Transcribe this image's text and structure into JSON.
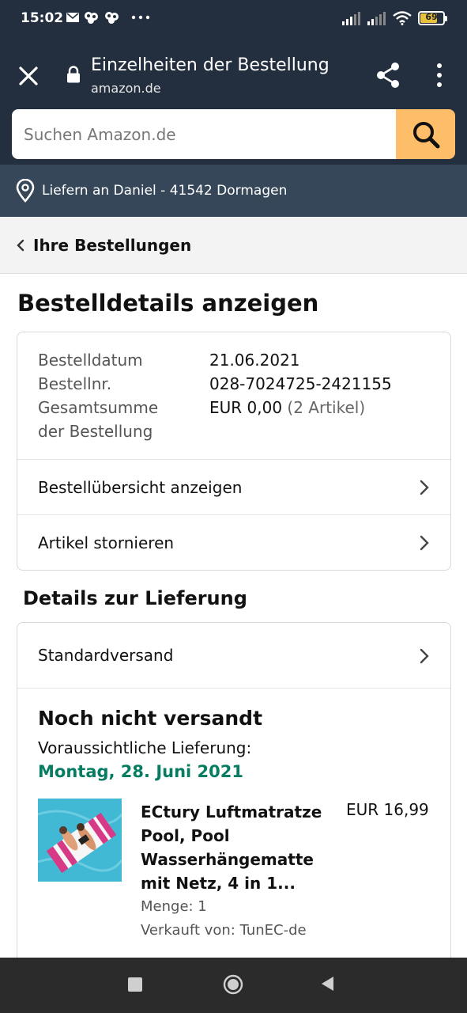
{
  "status_bar": {
    "time": "15:02",
    "battery": "69",
    "battery_level": 0.69,
    "icons": [
      "mail-icon",
      "notification-icon",
      "notification-icon",
      "more-dots-icon",
      "signal-icon",
      "signal-icon",
      "wifi-icon",
      "battery-icon"
    ]
  },
  "browser": {
    "title": "Einzelheiten der Bestellung",
    "domain": "amazon.de"
  },
  "search": {
    "placeholder": "Suchen Amazon.de",
    "button_color": "#febd69"
  },
  "delivery_bar": {
    "text": "Liefern an Daniel - 41542 Dormagen"
  },
  "back_nav": {
    "label": "Ihre Bestellungen"
  },
  "page_title": "Bestelldetails anzeigen",
  "order": {
    "date_label": "Bestelldatum",
    "date_value": "21.06.2021",
    "number_label": "Bestellnr.",
    "number_value": "028-7024725-2421155",
    "total_label_1": "Gesamtsumme",
    "total_label_2": "der Bestellung",
    "total_value": "EUR 0,00",
    "total_items": "(2 Artikel)",
    "links": [
      {
        "label": "Bestellübersicht anzeigen"
      },
      {
        "label": "Artikel stornieren"
      }
    ]
  },
  "delivery": {
    "section_title": "Details zur Lieferung",
    "shipping_method": "Standardversand",
    "status": "Noch nicht versandt",
    "expected_label": "Voraussichtliche Lieferung:",
    "expected_date": "Montag, 28. Juni 2021",
    "date_color": "#067d62"
  },
  "product": {
    "title": "ECtury Luftmatratze Pool, Pool Wasserhängematte mit Netz, 4 in 1...",
    "price": "EUR 16,99",
    "quantity": "Menge: 1",
    "seller": "Verkauft von: TunEC-de"
  },
  "colors": {
    "header_bg": "#232f3e",
    "deliver_bg": "#37475a"
  }
}
